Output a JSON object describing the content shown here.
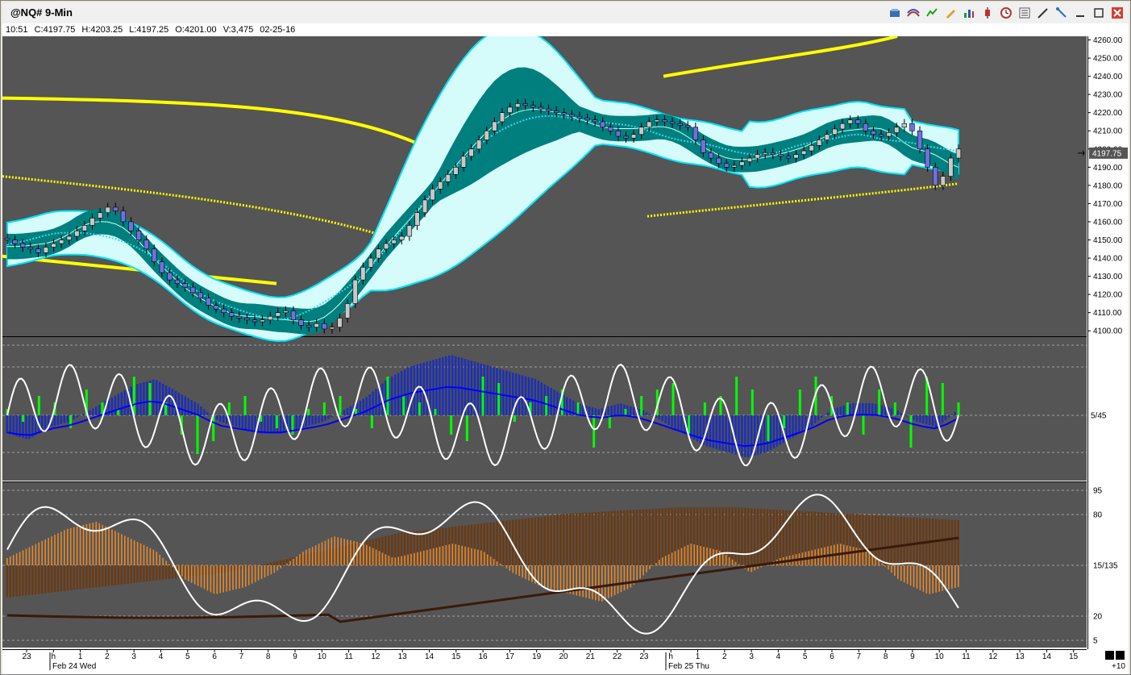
{
  "window": {
    "title": "@NQ# 9-Min"
  },
  "toolbar": {
    "icons": [
      "data-window-icon",
      "drawing-icon",
      "indicator-icon",
      "pencil-icon",
      "bar-chart-icon",
      "candlestick-icon",
      "clock-icon",
      "list-icon",
      "pen-icon",
      "pointer-icon",
      "minimize-icon",
      "maximize-icon",
      "close-icon"
    ]
  },
  "quote": {
    "time": "10:51",
    "close": "C:4197.75",
    "high": "H:4203.25",
    "low": "L:4197.25",
    "open": "O:4201.00",
    "volume": "V:3,475",
    "date": "02-25-16"
  },
  "price_axis": {
    "ticks": [
      "4260.00",
      "4250.00",
      "4240.00",
      "4230.00",
      "4220.00",
      "4210.00",
      "4200.00",
      "4190.00",
      "4180.00",
      "4170.00",
      "4160.00",
      "4150.00",
      "4140.00",
      "4130.00",
      "4120.00",
      "4110.00",
      "4100.00"
    ],
    "last_price": "4197.75"
  },
  "osc1_axis": {
    "label": "5/45"
  },
  "osc2_axis": {
    "ticks": [
      "95",
      "80",
      "15/135",
      "20",
      "5"
    ]
  },
  "time_axis": {
    "ticks": [
      "23",
      "h",
      "1",
      "2",
      "3",
      "4",
      "5",
      "6",
      "7",
      "8",
      "9",
      "10",
      "11",
      "12",
      "13",
      "14",
      "15",
      "16",
      "17",
      "19",
      "20",
      "21",
      "22",
      "23",
      "h",
      "1",
      "2",
      "3",
      "4",
      "5",
      "6",
      "7",
      "8",
      "9",
      "10",
      "11",
      "12",
      "13",
      "14",
      "15"
    ],
    "day_labels": [
      "Feb 24 Wed",
      "Feb 25 Thu"
    ],
    "extra": "+10"
  },
  "colors": {
    "background": "#555555",
    "band_outer": "#d6fbfb",
    "band_inner": "#007f7f",
    "band_edge": "#00e5ff",
    "yellow": "#ffff00",
    "green_hist": "#00ff00",
    "blue_hist": "#1c2fb5",
    "blue_line": "#0000ff",
    "orange_hist": "#e88a2a",
    "brown_hist": "#6b3a12",
    "dark_line": "#3a1a0a"
  },
  "chart_data": [
    {
      "type": "candlestick",
      "title": "@NQ# 9-Min",
      "ylim": [
        4097,
        4262
      ],
      "close_series": [
        4150,
        4148,
        4146,
        4145,
        4143,
        4146,
        4148,
        4150,
        4152,
        4155,
        4158,
        4162,
        4165,
        4168,
        4166,
        4160,
        4155,
        4150,
        4145,
        4138,
        4132,
        4128,
        4126,
        4124,
        4121,
        4118,
        4114,
        4112,
        4110,
        4108,
        4107,
        4106,
        4105,
        4106,
        4108,
        4110,
        4111,
        4106,
        4103,
        4102,
        4104,
        4101,
        4102,
        4107,
        4115,
        4128,
        4135,
        4140,
        4145,
        4148,
        4150,
        4152,
        4158,
        4165,
        4172,
        4178,
        4182,
        4186,
        4190,
        4196,
        4200,
        4205,
        4210,
        4215,
        4220,
        4223,
        4225,
        4224,
        4223,
        4222,
        4221,
        4220,
        4219,
        4218,
        4217,
        4216,
        4215,
        4212,
        4210,
        4207,
        4206,
        4208,
        4212,
        4215,
        4216,
        4215,
        4214,
        4213,
        4212,
        4205,
        4198,
        4195,
        4192,
        4190,
        4191,
        4193,
        4195,
        4197,
        4198,
        4197,
        4196,
        4195,
        4197,
        4199,
        4202,
        4205,
        4208,
        4211,
        4214,
        4216,
        4214,
        4210,
        4208,
        4207,
        4209,
        4212,
        4214,
        4210,
        4200,
        4190,
        4180,
        4185,
        4195,
        4200
      ],
      "indicators": [
        "yellow long-term envelope",
        "bollinger-style bands",
        "moving average"
      ]
    },
    {
      "type": "bar",
      "ylabel": "5/45",
      "series": [
        {
          "values": [
            0.1,
            -0.1,
            0.3,
            0.2,
            -0.2,
            0.4,
            0.2,
            0.1,
            0.6,
            0.5,
            0.2,
            -0.3,
            -0.6,
            -0.4,
            0.2,
            0.3,
            -0.1,
            -0.2,
            -0.3,
            0.1,
            0.2,
            0.3,
            0.1,
            -0.2,
            0.6,
            0.3,
            0.2,
            0.1,
            -0.3,
            -0.4,
            0.6,
            0.5,
            -0.1,
            0.2,
            0.3,
            0.4,
            0.2,
            -0.5,
            -0.2,
            0.1,
            0.3,
            0.4,
            0.5,
            -0.3,
            0.2,
            0.3,
            0.6,
            0.4,
            -0.4,
            -0.2,
            0.4,
            0.6,
            0.3,
            0.2,
            -0.3,
            0.4,
            0.2,
            -0.5,
            0.6,
            0.5,
            0.2
          ]
        },
        {
          "values": [
            -0.3,
            -0.4,
            -0.2,
            -0.1,
            0.1,
            0.3,
            0.5,
            0.6,
            0.4,
            0.2,
            -0.1,
            -0.2,
            -0.3,
            -0.3,
            -0.2,
            -0.1,
            0.1,
            0.3,
            0.6,
            0.8,
            0.9,
            1.0,
            0.9,
            0.8,
            0.7,
            0.6,
            0.4,
            0.2,
            0.1,
            0.2,
            0.1,
            -0.1,
            -0.3,
            -0.5,
            -0.6,
            -0.7,
            -0.6,
            -0.4,
            -0.2,
            0.1,
            0.2,
            0.2,
            0.1,
            -0.1,
            -0.2,
            0.1
          ]
        }
      ]
    },
    {
      "type": "bar",
      "ylabel": "15/135",
      "series": [
        {
          "values": [
            0.1,
            0.3,
            0.5,
            0.6,
            0.4,
            0.2,
            -0.2,
            -0.4,
            -0.3,
            -0.1,
            0.2,
            0.4,
            0.3,
            0.1,
            0.2,
            0.3,
            0.2,
            -0.1,
            -0.3,
            -0.4,
            -0.5,
            -0.3,
            0.1,
            0.3,
            0.2,
            -0.1,
            0.1,
            0.2,
            0.3,
            0.2,
            -0.2,
            -0.4,
            -0.3
          ]
        },
        {
          "values": [
            -0.5,
            -0.4,
            -0.3,
            -0.2,
            -0.1,
            0.1,
            0.3,
            0.5,
            0.6,
            0.7,
            0.8,
            0.85,
            0.9,
            0.9,
            0.85,
            0.8,
            0.75,
            0.7
          ]
        }
      ]
    }
  ]
}
